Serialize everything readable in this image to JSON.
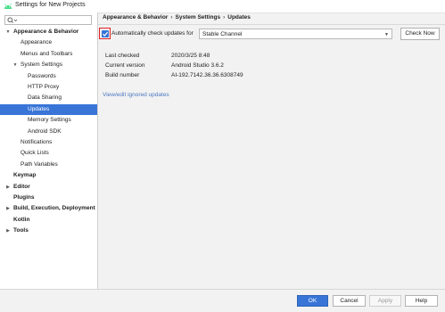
{
  "window": {
    "title": "Settings for New Projects",
    "app_icon": "android-icon"
  },
  "search": {
    "placeholder": "",
    "value": ""
  },
  "tree": [
    {
      "label": "Appearance & Behavior",
      "bold": true,
      "arrow": "expanded"
    },
    {
      "label": "Appearance",
      "bold": false,
      "arrow": "none"
    },
    {
      "label": "Menus and Toolbars",
      "bold": false,
      "arrow": "none"
    },
    {
      "label": "System Settings",
      "bold": false,
      "arrow": "expanded"
    },
    {
      "label": "Passwords",
      "bold": false,
      "arrow": "none"
    },
    {
      "label": "HTTP Proxy",
      "bold": false,
      "arrow": "none"
    },
    {
      "label": "Data Sharing",
      "bold": false,
      "arrow": "none"
    },
    {
      "label": "Updates",
      "bold": false,
      "arrow": "none",
      "selected": true
    },
    {
      "label": "Memory Settings",
      "bold": false,
      "arrow": "none"
    },
    {
      "label": "Android SDK",
      "bold": false,
      "arrow": "none"
    },
    {
      "label": "Notifications",
      "bold": false,
      "arrow": "none"
    },
    {
      "label": "Quick Lists",
      "bold": false,
      "arrow": "none"
    },
    {
      "label": "Path Variables",
      "bold": false,
      "arrow": "none"
    },
    {
      "label": "Keymap",
      "bold": true,
      "arrow": "none"
    },
    {
      "label": "Editor",
      "bold": true,
      "arrow": "collapsed"
    },
    {
      "label": "Plugins",
      "bold": true,
      "arrow": "none"
    },
    {
      "label": "Build, Execution, Deployment",
      "bold": true,
      "arrow": "collapsed"
    },
    {
      "label": "Kotlin",
      "bold": true,
      "arrow": "none"
    },
    {
      "label": "Tools",
      "bold": true,
      "arrow": "collapsed"
    }
  ],
  "breadcrumb": [
    "Appearance & Behavior",
    "System Settings",
    "Updates"
  ],
  "updates": {
    "auto_check_label": "Automatically check updates for",
    "auto_check_checked": true,
    "channel": "Stable Channel",
    "check_now_label": "Check Now",
    "info": [
      {
        "key": "Last checked",
        "value": "2020/3/25 8:48"
      },
      {
        "key": "Current version",
        "value": "Android Studio 3.6.2"
      },
      {
        "key": "Build number",
        "value": "AI-192.7142.36.36.6308749"
      }
    ],
    "ignored_link": "View/edit ignored updates"
  },
  "footer": {
    "ok": "OK",
    "cancel": "Cancel",
    "apply": "Apply",
    "help": "Help"
  },
  "colors": {
    "accent": "#3875d7",
    "highlight_box": "#e02020",
    "link": "#4a78c2"
  }
}
